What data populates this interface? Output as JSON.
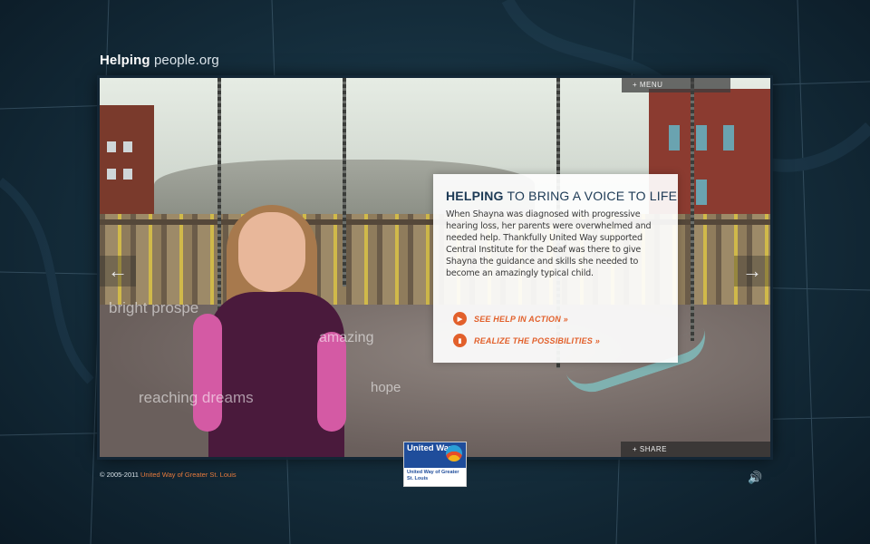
{
  "site": {
    "logo_bold": "Helping",
    "logo_light": "people.org"
  },
  "nav": {
    "menu_label": "+ MENU",
    "share_label": "+ SHARE",
    "prev_arrow": "←",
    "next_arrow": "→"
  },
  "video": {
    "overlay_words": [
      "bright prospe",
      "amazing",
      "reaching dreams",
      "hope"
    ]
  },
  "card": {
    "title_bold": "HELPING",
    "title_rest": " TO BRING A VOICE TO LIFE",
    "body": "When Shayna was diagnosed with progressive hearing loss, her parents were overwhelmed and needed help. Thankfully United Way supported Central Institute for the Deaf was there to give Shayna the guidance and skills she needed to become an amazingly typical child.",
    "cta1": "SEE HELP IN ACTION »",
    "cta2": "REALIZE THE POSSIBILITIES »"
  },
  "footer": {
    "copyright": "© 2005-2011",
    "org_link": "United Way of Greater St. Louis",
    "uw_logo_top": "United Way",
    "uw_logo_sub": "United Way of Greater St. Louis",
    "sound_icon": "speaker-icon"
  },
  "colors": {
    "accent": "#e2602b",
    "title": "#1d3a55",
    "uw_blue": "#1f4d9b"
  }
}
